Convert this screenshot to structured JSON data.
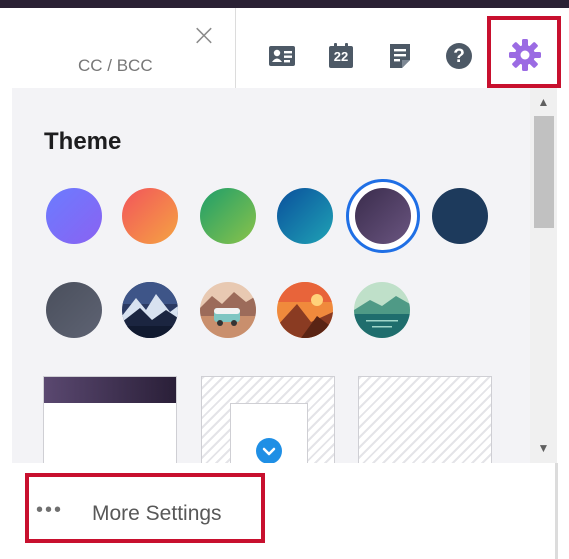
{
  "header": {
    "cc_bcc_label": "CC / BCC",
    "close_glyph": "×",
    "toolbar": {
      "contacts_icon": "contact-card-icon",
      "calendar_day": "22",
      "notes_icon": "notes-icon",
      "help_glyph": "?",
      "settings_icon": "gear-icon"
    }
  },
  "theme_panel": {
    "title": "Theme",
    "swatches_row1": [
      {
        "name": "blue-purple",
        "from": "#6b7cff",
        "to": "#8a62f2"
      },
      {
        "name": "sunset",
        "from": "#f2545b",
        "to": "#f5a442"
      },
      {
        "name": "green",
        "from": "#1e9e6a",
        "to": "#8bc34a"
      },
      {
        "name": "ocean",
        "from": "#0a4f9c",
        "to": "#1fa3b5"
      },
      {
        "name": "dark-purple",
        "from": "#3a2c4c",
        "to": "#6a5580",
        "selected": true
      },
      {
        "name": "navy",
        "from": "#1d3a5c",
        "to": "#1d3a5c"
      }
    ],
    "swatches_row2": [
      {
        "name": "slate",
        "from": "#4a4f5c",
        "to": "#5e6373"
      },
      {
        "name": "mountains-scene"
      },
      {
        "name": "camper-scene"
      },
      {
        "name": "desert-scene"
      },
      {
        "name": "lake-scene"
      }
    ],
    "scroll_up_glyph": "▲",
    "scroll_down_glyph": "▼",
    "chevron_glyph": "⌄"
  },
  "footer": {
    "dots": "•••",
    "more_settings_label": "More Settings"
  },
  "colors": {
    "top_strip": "#2a2134",
    "highlight": "#c8102e",
    "selected_ring": "#1f6fe5",
    "toolbar_icon": "#4d5966",
    "settings_gear": "#9b6be3"
  }
}
